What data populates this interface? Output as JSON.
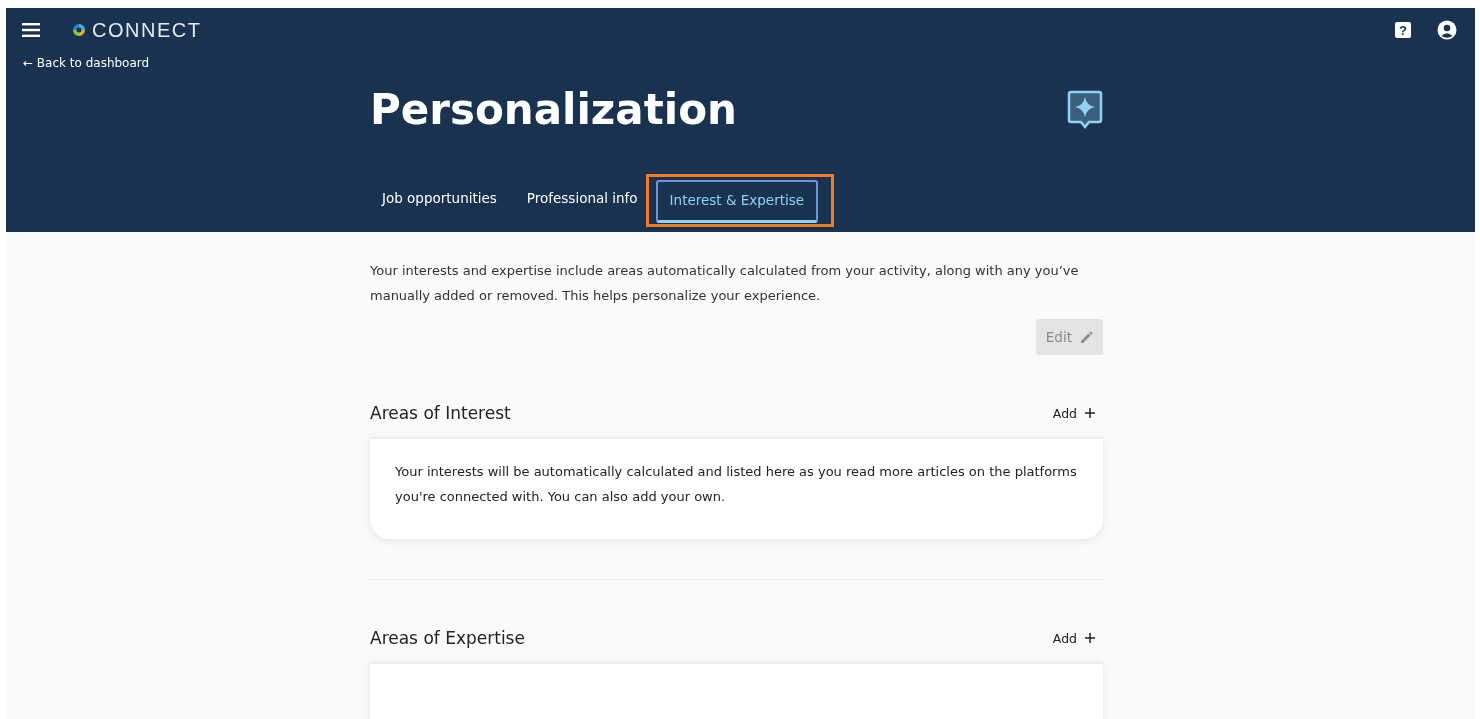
{
  "app": {
    "brand": "CONNECT",
    "back_link": "← Back to dashboard",
    "help_glyph": "?"
  },
  "page": {
    "title": "Personalization"
  },
  "tabs": [
    {
      "label": "Job opportunities",
      "selected": false
    },
    {
      "label": "Professional info",
      "selected": false
    },
    {
      "label": "Interest & Expertise",
      "selected": true,
      "highlighted": true
    }
  ],
  "intro": "Your interests and expertise include areas automatically calculated from your activity, along with any you’ve manually added or removed. This helps personalize your experience.",
  "edit_button": {
    "label": "Edit",
    "disabled": true
  },
  "sections": [
    {
      "title": "Areas of Interest",
      "add_label": "Add",
      "card_text": "Your interests will be automatically calculated and listed here as you read more articles on the platforms you're connected with. You can also add your own."
    },
    {
      "title": "Areas of Expertise",
      "add_label": "Add"
    }
  ]
}
